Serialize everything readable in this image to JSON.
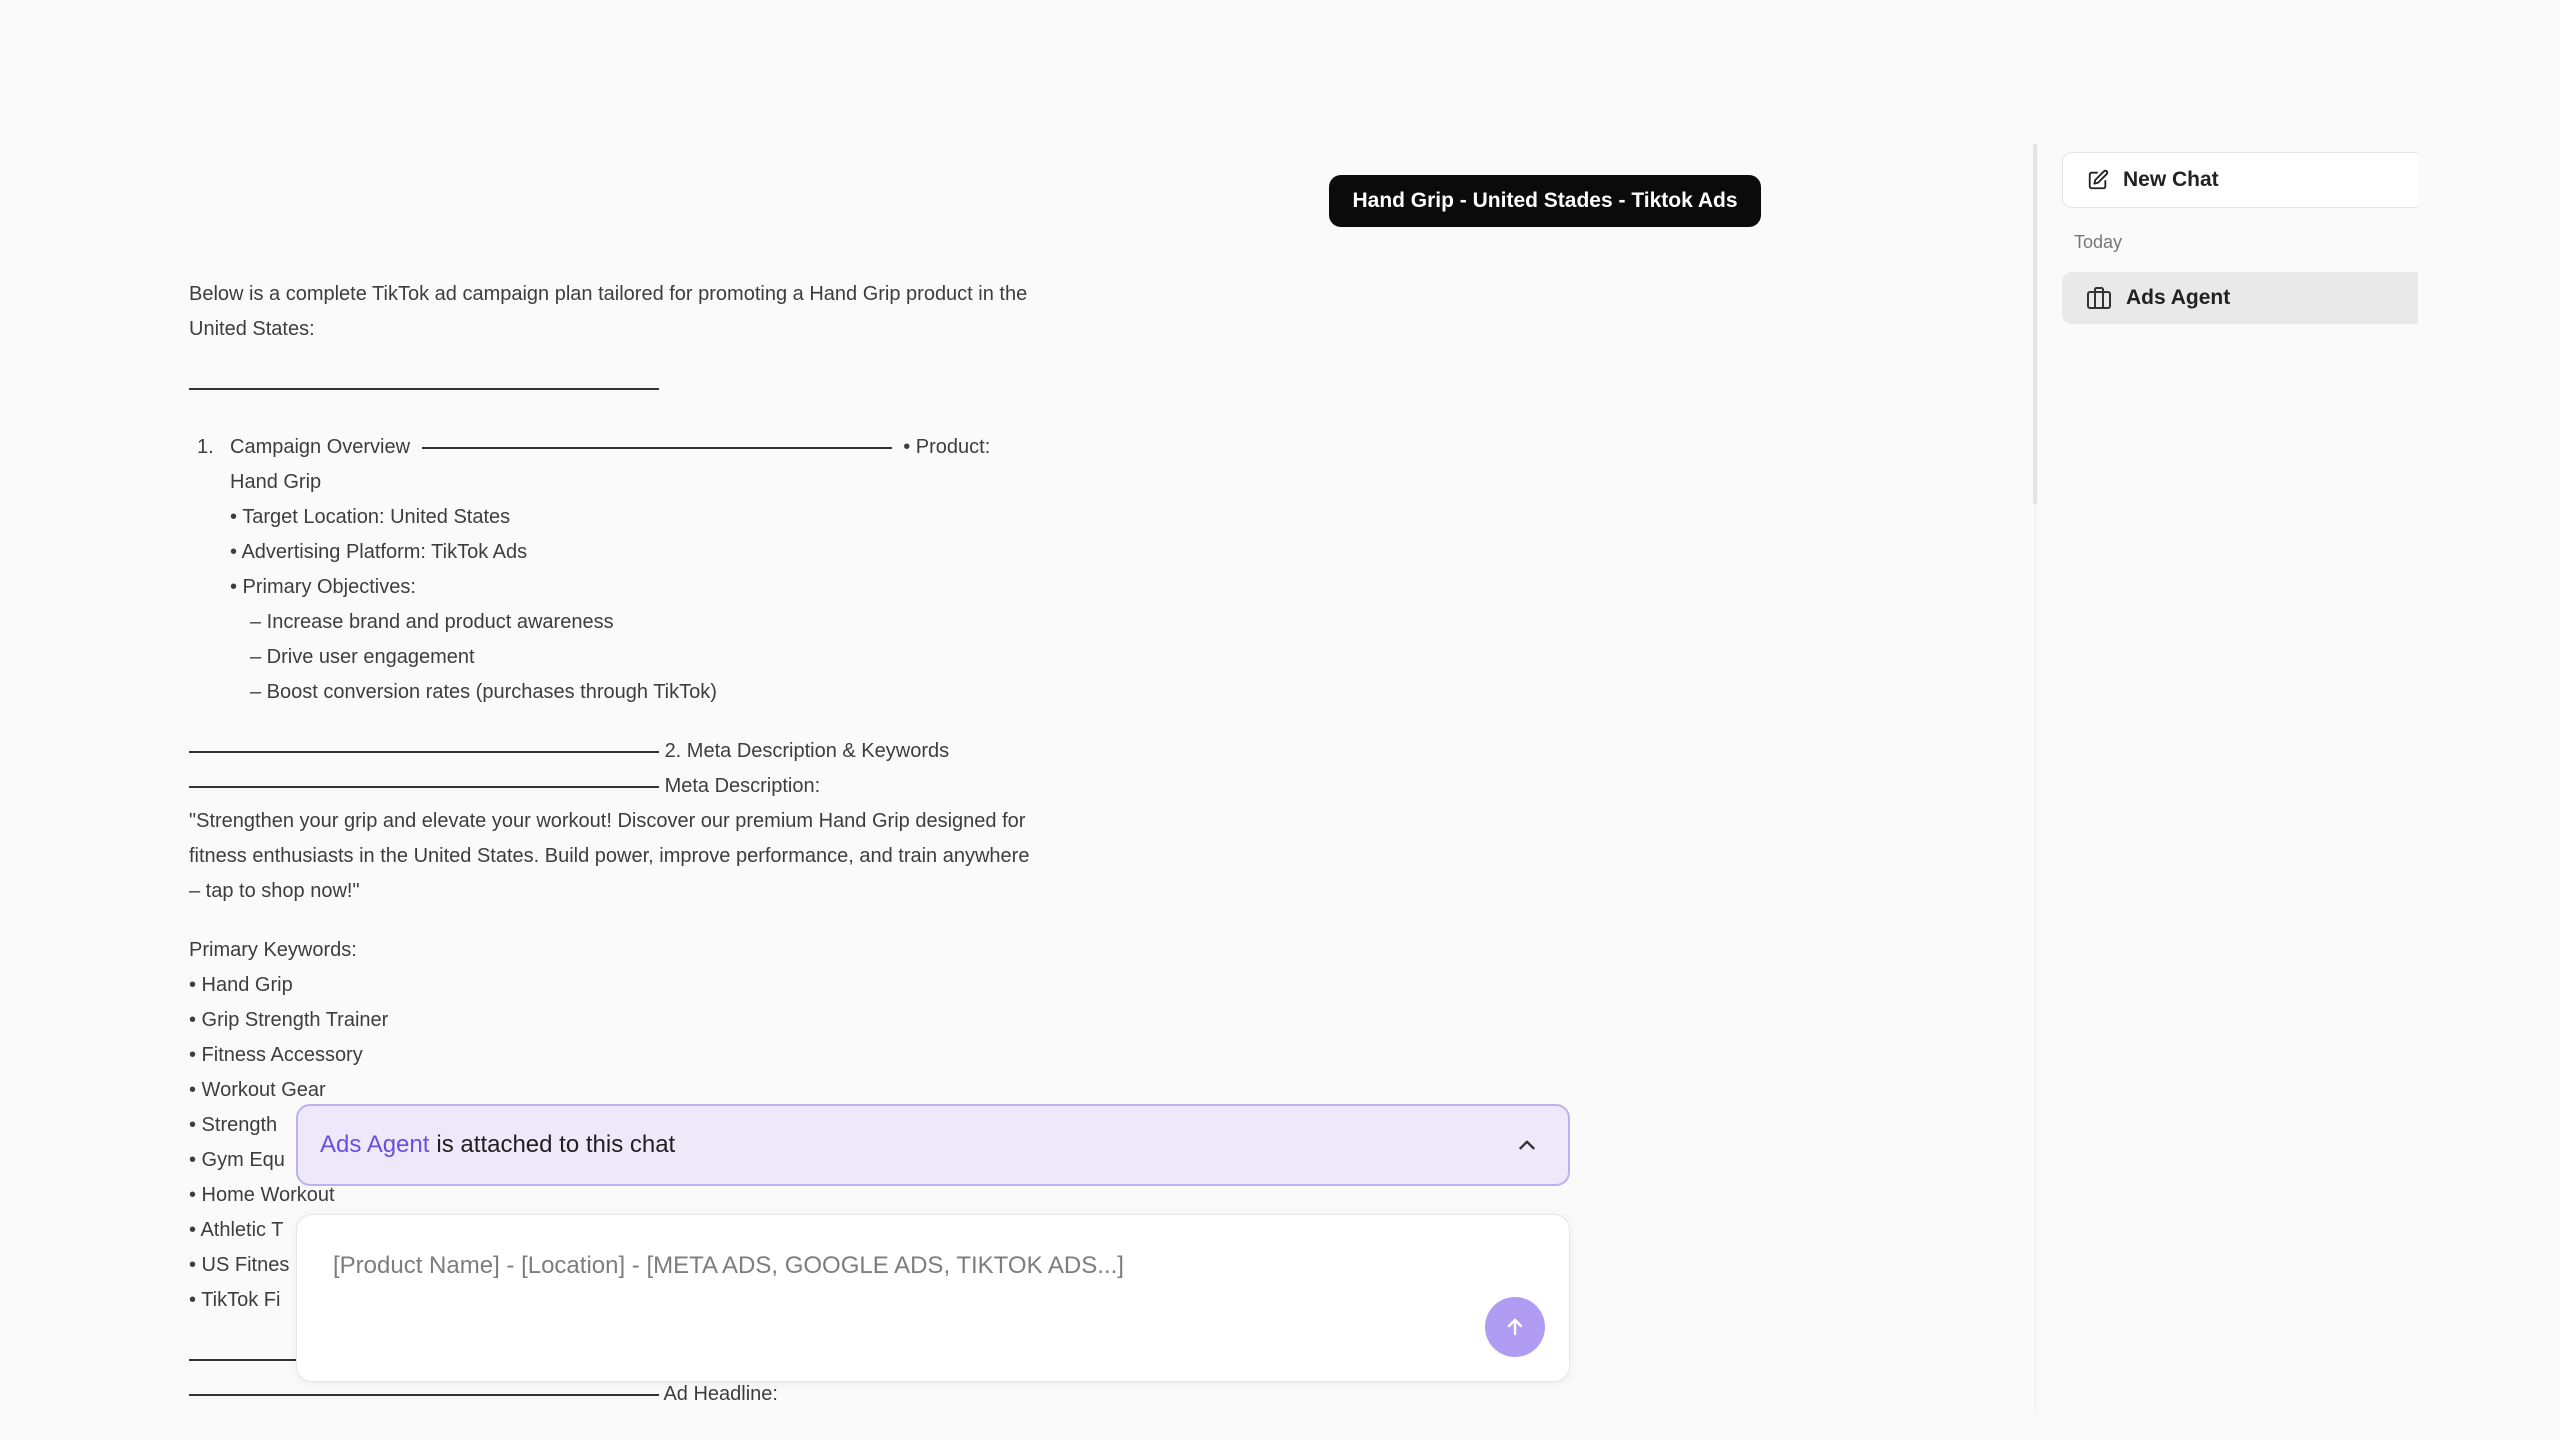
{
  "user_message": "Hand Grip - United Stades - Tiktok Ads",
  "response": {
    "intro": "Below is a complete TikTok ad campaign plan tailored for promoting a Hand Grip product in the United States:",
    "item1": {
      "number": "1.",
      "title": "Campaign Overview",
      "tail_line1": "• Product:",
      "tail_line2": "Hand Grip"
    },
    "overview_bullets": [
      "• Target Location: United States",
      "• Advertising Platform: TikTok Ads",
      "• Primary Objectives:"
    ],
    "objectives": [
      "– Increase brand and product awareness",
      "– Drive user engagement",
      "– Boost conversion rates (purchases through TikTok)"
    ],
    "section2_heading": "2. Meta Description & Keywords",
    "meta_desc_label": "Meta Description:",
    "meta_desc_text": "\"Strengthen your grip and elevate your workout! Discover our premium Hand Grip designed for fitness enthusiasts in the United States. Build power, improve performance, and train anywhere – tap to shop now!\"",
    "keywords_label": "Primary Keywords:",
    "keywords": [
      "• Hand Grip",
      "• Grip Strength Trainer",
      "• Fitness Accessory",
      "• Workout Gear",
      "• Strength",
      "• Gym Equ",
      "• Home Workout",
      "• Athletic T",
      "• US Fitnes",
      "• TikTok Fi"
    ],
    "ad_headline_label": "Ad Headline:"
  },
  "attachment": {
    "agent": "Ads Agent",
    "text": "is attached to this chat"
  },
  "composer": {
    "placeholder": "[Product Name] - [Location] - [META ADS, GOOGLE ADS, TIKTOK ADS...]"
  },
  "sidebar": {
    "new_chat_label": "New Chat",
    "section_today": "Today",
    "items": [
      {
        "label": "Ads Agent"
      }
    ]
  },
  "icons": {
    "new_chat": "edit-icon",
    "chat_item": "briefcase-icon",
    "send": "arrow-up-icon",
    "collapse": "chevron-up-icon"
  },
  "colors": {
    "accent": "#6b4fe0",
    "send_button": "#b19cf3",
    "attach_bg": "#ede9fb",
    "pill_bg": "#0b0b0b"
  }
}
